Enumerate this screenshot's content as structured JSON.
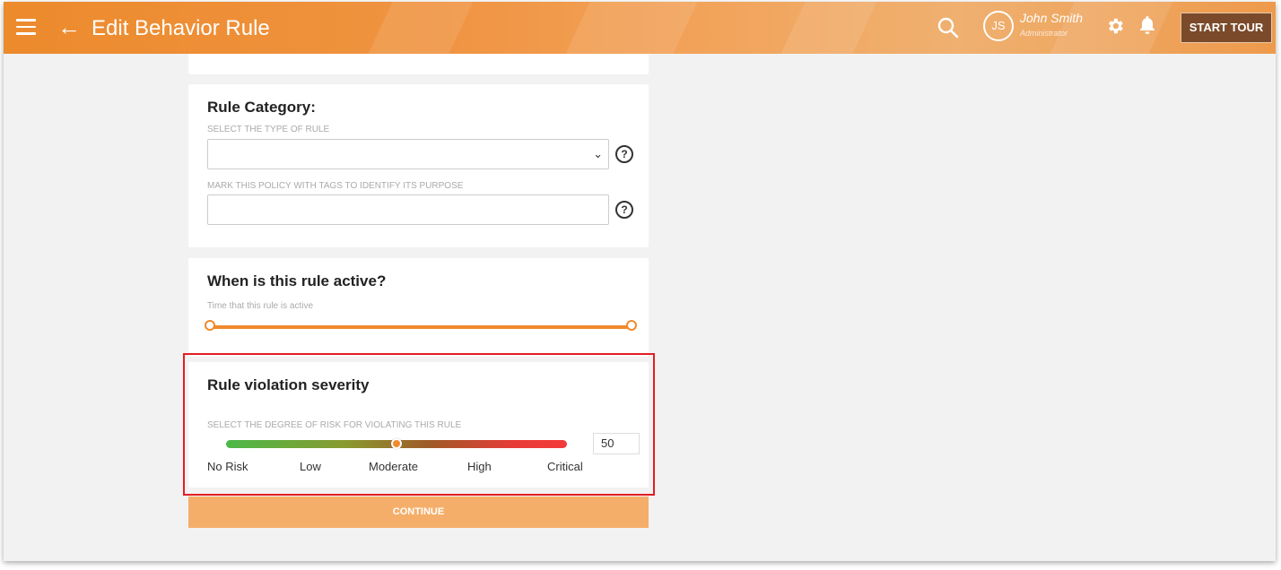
{
  "header": {
    "title": "Edit Behavior Rule",
    "menu_icon": "hamburger-menu-icon",
    "back_icon": "arrow-left-icon",
    "search_icon": "search-icon",
    "user": {
      "initials": "JS",
      "name": "John Smith",
      "role": "Administrator"
    },
    "settings_icon": "gear-icon",
    "notifications_icon": "bell-icon",
    "tour_button": "START TOUR"
  },
  "rule_category": {
    "title": "Rule Category:",
    "type_label": "SELECT THE TYPE OF RULE",
    "type_value": "",
    "tags_label": "MARK THIS POLICY WITH TAGS TO IDENTIFY ITS PURPOSE",
    "tags_value": "",
    "help_glyph": "?"
  },
  "rule_active": {
    "title": "When is this rule active?",
    "help_text": "Time that this rule is active",
    "range_start": 0,
    "range_end": 1
  },
  "severity": {
    "title": "Rule violation severity",
    "label": "SELECT THE DEGREE OF RISK FOR VIOLATING THIS RULE",
    "value": "50",
    "min": 0,
    "max": 100,
    "ticks": [
      "No Risk",
      "Low",
      "Moderate",
      "High",
      "Critical"
    ]
  },
  "continue_button": "CONTINUE",
  "colors": {
    "brand": "#f08a2c",
    "highlight": "#e31e24",
    "tour_button": "#7a4a2a"
  }
}
